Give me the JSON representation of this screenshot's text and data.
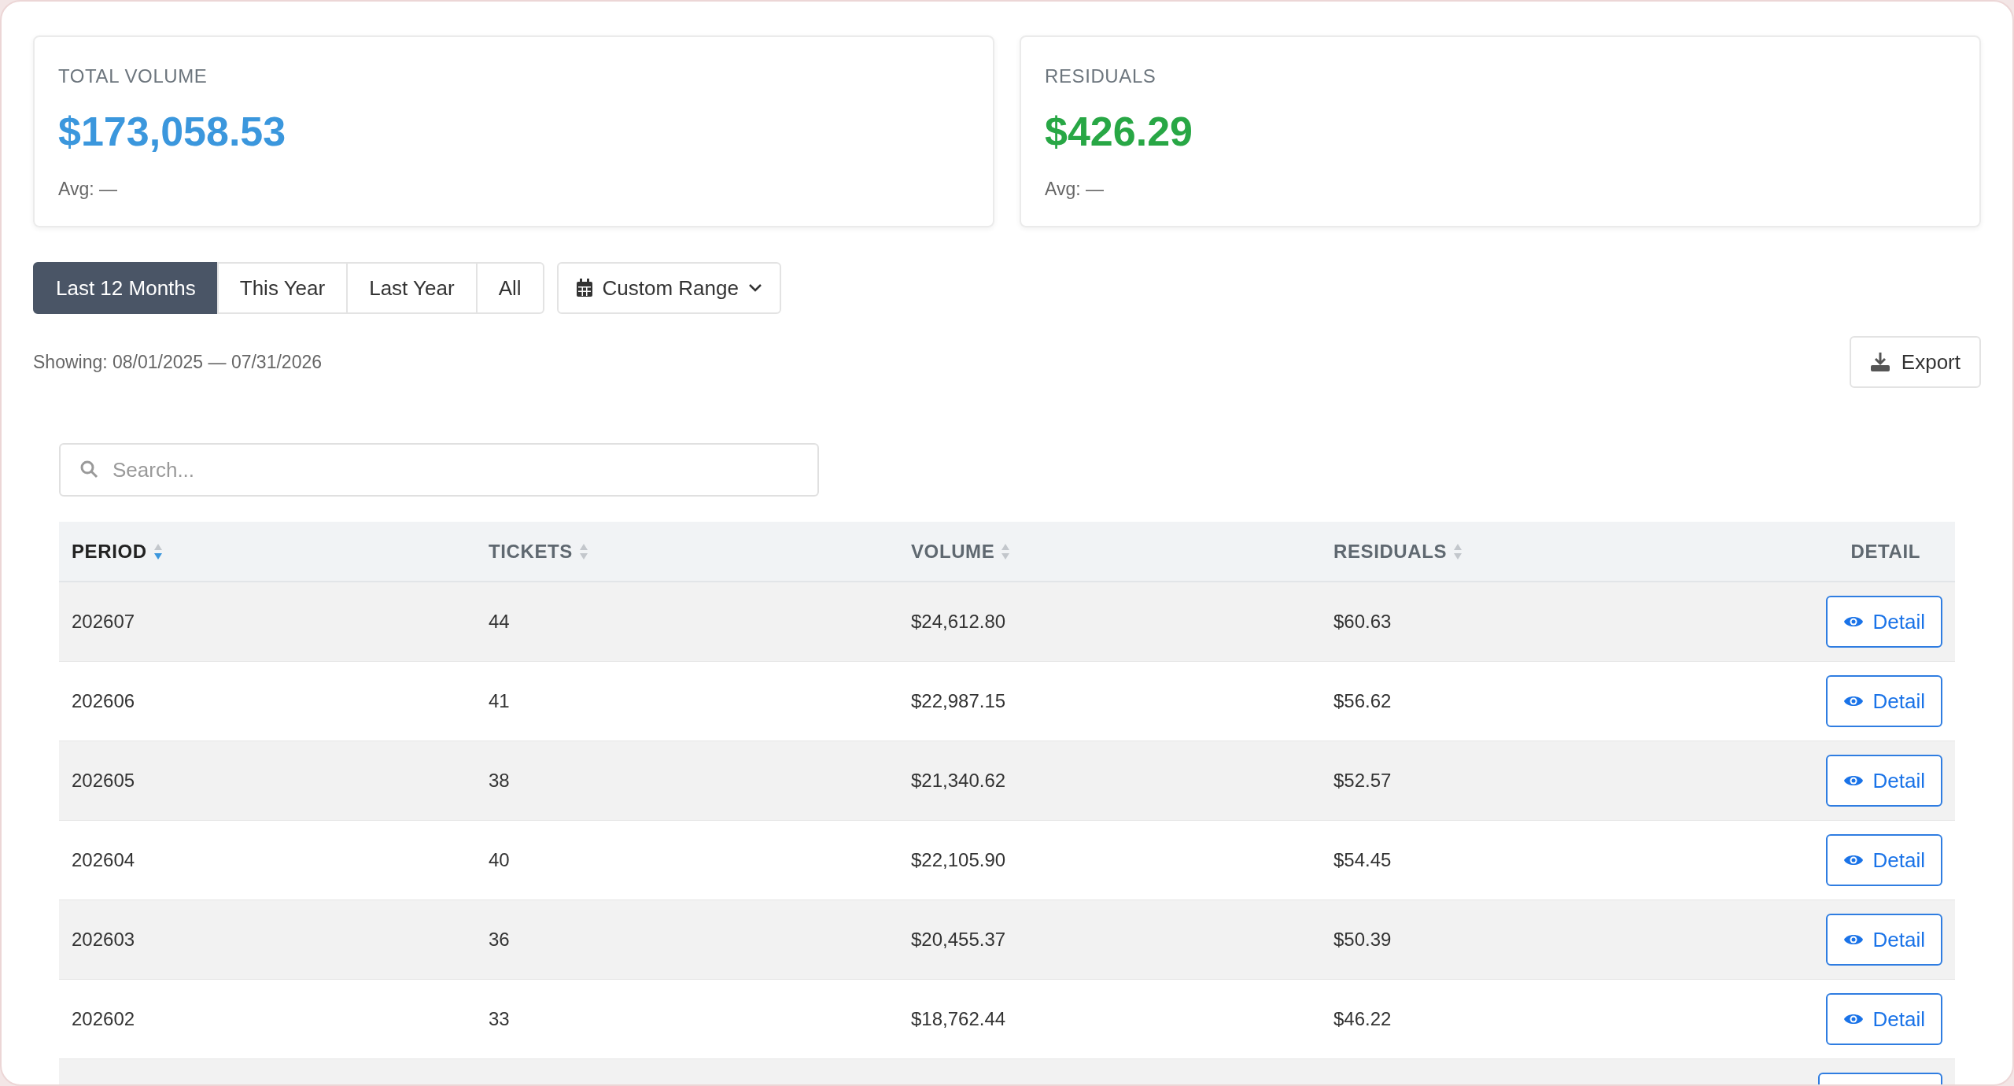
{
  "summary_cards": [
    {
      "label": "TOTAL VOLUME",
      "value": "$173,058.53",
      "color": "#3b97dd",
      "avg": "Avg: —"
    },
    {
      "label": "RESIDUALS",
      "value": "$426.29",
      "color": "#28a745",
      "avg": "Avg: —"
    }
  ],
  "range_tabs": [
    {
      "label": "Last 12 Months",
      "selected": true
    },
    {
      "label": "This Year",
      "selected": false
    },
    {
      "label": "Last Year",
      "selected": false
    },
    {
      "label": "All",
      "selected": false
    }
  ],
  "custom_range": {
    "label": "Custom Range"
  },
  "showing": "Showing: 08/01/2025 — 07/31/2026",
  "export_button": "Export",
  "search": {
    "placeholder": "Search..."
  },
  "table": {
    "columns": [
      {
        "label": "PERIOD",
        "sortable": true,
        "sorted": true
      },
      {
        "label": "TICKETS",
        "sortable": true,
        "sorted": false
      },
      {
        "label": "VOLUME",
        "sortable": true,
        "sorted": false
      },
      {
        "label": "RESIDUALS",
        "sortable": true,
        "sorted": false
      },
      {
        "label": "DETAIL",
        "sortable": false,
        "sorted": false
      }
    ],
    "rows": [
      {
        "cells": [
          "202607",
          "44",
          "$24,612.80",
          "$60.63"
        ],
        "action": "Detail"
      },
      {
        "cells": [
          "202606",
          "41",
          "$22,987.15",
          "$56.62"
        ],
        "action": "Detail"
      },
      {
        "cells": [
          "202605",
          "38",
          "$21,340.62",
          "$52.57"
        ],
        "action": "Detail"
      },
      {
        "cells": [
          "202604",
          "40",
          "$22,105.90",
          "$54.45"
        ],
        "action": "Detail"
      },
      {
        "cells": [
          "202603",
          "36",
          "$20,455.37",
          "$50.39"
        ],
        "action": "Detail"
      },
      {
        "cells": [
          "202602",
          "33",
          "$18,762.44",
          "$46.22"
        ],
        "action": "Detail"
      }
    ]
  }
}
